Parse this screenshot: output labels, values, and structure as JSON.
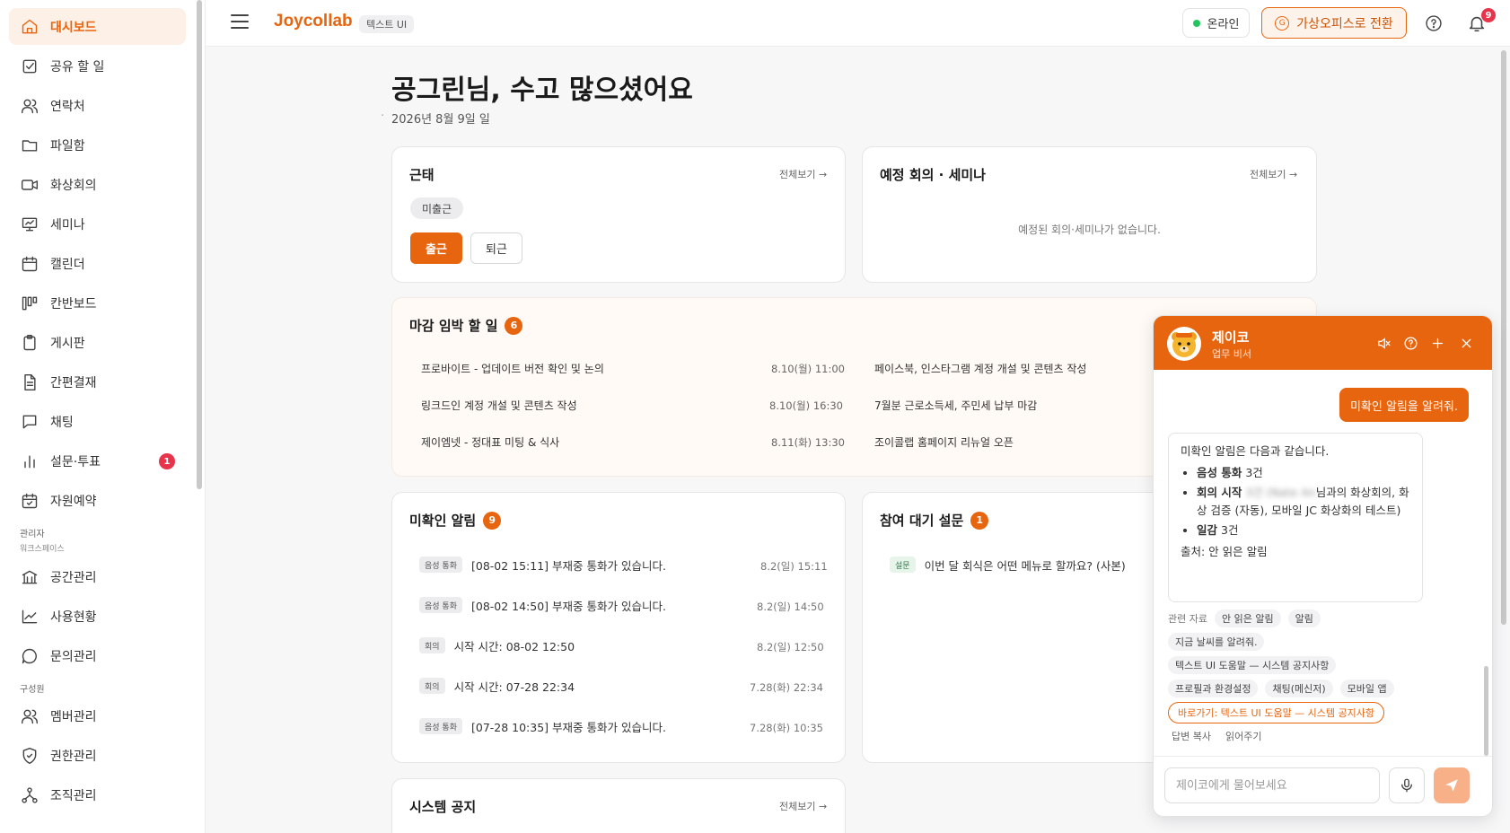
{
  "sidebar": {
    "items": [
      {
        "label": "대시보드",
        "icon": "home-icon"
      },
      {
        "label": "공유 할 일",
        "icon": "checkbox-icon"
      },
      {
        "label": "연락처",
        "icon": "users-icon"
      },
      {
        "label": "파일함",
        "icon": "folder-icon"
      },
      {
        "label": "화상회의",
        "icon": "video-icon"
      },
      {
        "label": "세미나",
        "icon": "presentation-icon"
      },
      {
        "label": "캘린더",
        "icon": "calendar-icon"
      },
      {
        "label": "칸반보드",
        "icon": "kanban-icon"
      },
      {
        "label": "게시판",
        "icon": "clipboard-icon"
      },
      {
        "label": "간편결재",
        "icon": "document-icon"
      },
      {
        "label": "채팅",
        "icon": "chat-icon"
      },
      {
        "label": "설문·투표",
        "icon": "bar-chart-icon",
        "badge": "1"
      },
      {
        "label": "자원예약",
        "icon": "calendar-check-icon"
      }
    ],
    "admin_section": "관리자",
    "workspace_sub": "워크스페이스",
    "admin_items": [
      {
        "label": "공간관리",
        "icon": "building-icon"
      },
      {
        "label": "사용현황",
        "icon": "trend-icon"
      },
      {
        "label": "문의관리",
        "icon": "message-icon"
      }
    ],
    "member_section": "구성원",
    "member_items": [
      {
        "label": "멤버관리",
        "icon": "users-icon"
      },
      {
        "label": "권한관리",
        "icon": "shield-icon"
      },
      {
        "label": "조직관리",
        "icon": "org-icon"
      }
    ]
  },
  "header": {
    "brand": "Joycollab",
    "tag": "텍스트 UI",
    "status": "온라인",
    "office_button": "가상오피스로 전환",
    "office_icon_letter": "G",
    "notification_count": "9"
  },
  "main": {
    "greeting": "공그린님, 수고 많으셨어요",
    "date": "2026년 8월 9일 일",
    "attendance": {
      "title": "근태",
      "view_all": "전체보기 →",
      "status_chip": "미출근",
      "checkin": "출근",
      "checkout": "퇴근"
    },
    "meetings": {
      "title": "예정 회의 · 세미나",
      "view_all": "전체보기 →",
      "empty": "예정된 회의·세미나가 없습니다."
    },
    "deadline": {
      "title": "마감 임박 할 일",
      "count": "6",
      "left": [
        {
          "text": "프로바이트 - 업데이트 버전 확인 및 논의",
          "date": "8.10(월) 11:00"
        },
        {
          "text": "링크드인 계정 개설 및 콘텐츠 작성",
          "date": "8.10(월) 16:30"
        },
        {
          "text": "제이엠넷 - 정대표 미팅 & 식사",
          "date": "8.11(화) 13:30"
        }
      ],
      "right": [
        {
          "text": "페이스북, 인스타그램 계정 개설 및 콘텐츠 작성"
        },
        {
          "text": "7월분 근로소득세, 주민세 납부 마감"
        },
        {
          "text": "조이콜랩 홈페이지 리뉴얼 오픈"
        }
      ]
    },
    "unread": {
      "title": "미확인 알림",
      "count": "9",
      "rows": [
        {
          "tag": "음성 통화",
          "text": "[08-02 15:11] 부재중 통화가 있습니다.",
          "time": "8.2(일) 15:11"
        },
        {
          "tag": "음성 통화",
          "text": "[08-02 14:50] 부재중 통화가 있습니다.",
          "time": "8.2(일) 14:50"
        },
        {
          "tag": "회의",
          "text": "시작 시간: 08-02 12:50",
          "time": "8.2(일) 12:50"
        },
        {
          "tag": "회의",
          "text": "시작 시간: 07-28 22:34",
          "time": "7.28(화) 22:34"
        },
        {
          "tag": "음성 통화",
          "text": "[07-28 10:35] 부재중 통화가 있습니다.",
          "time": "7.28(화) 10:35"
        }
      ]
    },
    "survey": {
      "title": "참여 대기 설문",
      "count": "1",
      "rows": [
        {
          "tag": "설문",
          "text": "이번 달 회식은 어떤 메뉴로 할까요? (사본)"
        }
      ]
    },
    "notice": {
      "title": "시스템 공지",
      "view_all": "전체보기 →"
    }
  },
  "chat": {
    "name": "제이코",
    "role": "업무 비서",
    "user_message": "미확인 알림을 알려줘.",
    "bot": {
      "intro": "미확인 알림은 다음과 같습니다.",
      "b1_strong": "음성 통화",
      "b1_rest": " 3건",
      "b2_strong": "회의 시작",
      "b2_blur": "3건 (Nate An",
      "b2_rest": "님과의 화상회의, 화상 검증 (자동), 모바일 JC 화상화의 테스트)",
      "b3_strong": "일감",
      "b3_rest": " 3건",
      "source": "출처: 안 읽은 알림"
    },
    "refs_label": "관련 자료",
    "refs": [
      "안 읽은 알림",
      "알림"
    ],
    "suggestions": [
      "지금 날씨를 알려줘.",
      "텍스트 UI 도움말 — 시스템 공지사항",
      "프로필과 환경설정",
      "채팅(메신저)",
      "모바일 앱"
    ],
    "shortcut": "바로가기: 텍스트 UI 도움말 — 시스템 공지사항",
    "copy_answer": "답변 복사",
    "read_aloud": "읽어주기",
    "input_placeholder": "제이코에게 물어보세요"
  },
  "colors": {
    "accent": "#e8650f",
    "badge_red": "#e8344a",
    "online_green": "#22c55e"
  }
}
